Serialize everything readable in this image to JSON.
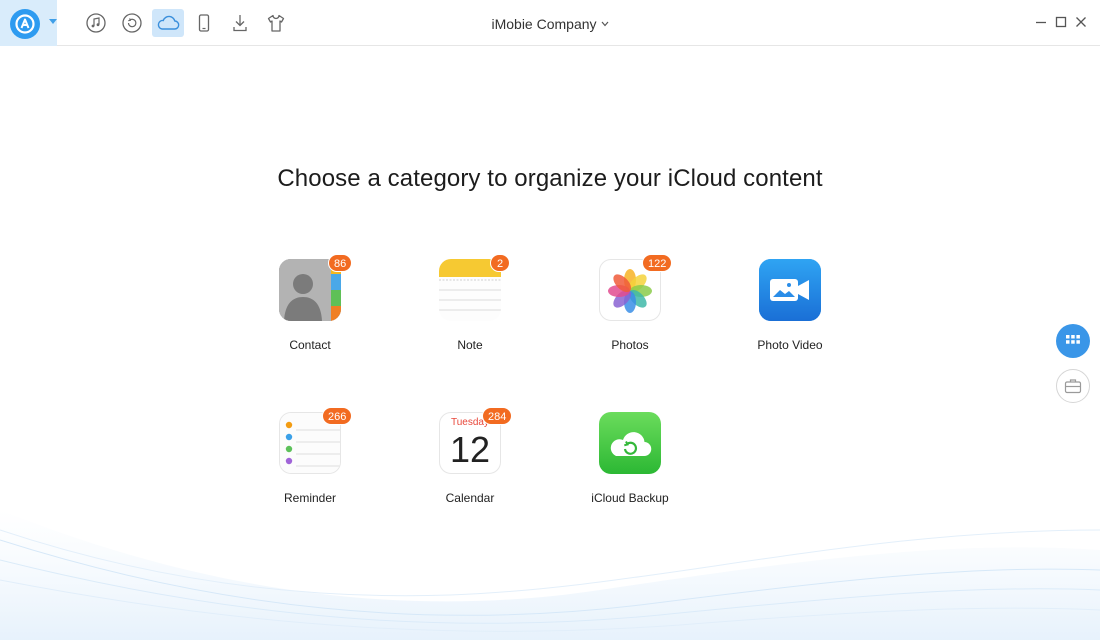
{
  "window": {
    "title": "iMobie Company",
    "controls": [
      "minimize",
      "maximize",
      "close"
    ]
  },
  "toolbar": {
    "logo_icon": "anytrans-logo-icon",
    "items": [
      {
        "name": "itunes-library",
        "icon": "music-note-icon",
        "active": false
      },
      {
        "name": "backup-manager",
        "icon": "restore-icon",
        "active": false
      },
      {
        "name": "icloud-manager",
        "icon": "cloud-icon",
        "active": true
      },
      {
        "name": "device-manager",
        "icon": "phone-icon",
        "active": false
      },
      {
        "name": "downloader",
        "icon": "download-icon",
        "active": false
      },
      {
        "name": "ringtone-shirt",
        "icon": "tshirt-icon",
        "active": false
      }
    ]
  },
  "main": {
    "heading": "Choose a category to organize your iCloud content",
    "categories": [
      {
        "label": "Contact",
        "badge": "86"
      },
      {
        "label": "Note",
        "badge": "2"
      },
      {
        "label": "Photos",
        "badge": "122"
      },
      {
        "label": "Photo Video",
        "badge": ""
      },
      {
        "label": "Reminder",
        "badge": "266"
      },
      {
        "label": "Calendar",
        "badge": "284"
      },
      {
        "label": "iCloud Backup",
        "badge": ""
      }
    ],
    "calendar_icon": {
      "day": "Tuesday",
      "date": "12"
    }
  },
  "side": {
    "buttons": [
      {
        "name": "grid-view",
        "icon": "grid-icon"
      },
      {
        "name": "toolbox",
        "icon": "briefcase-icon"
      }
    ]
  },
  "colors": {
    "accent": "#2e9bf0",
    "active_tab": "#cfe6fa",
    "badge": "#f26b21"
  }
}
